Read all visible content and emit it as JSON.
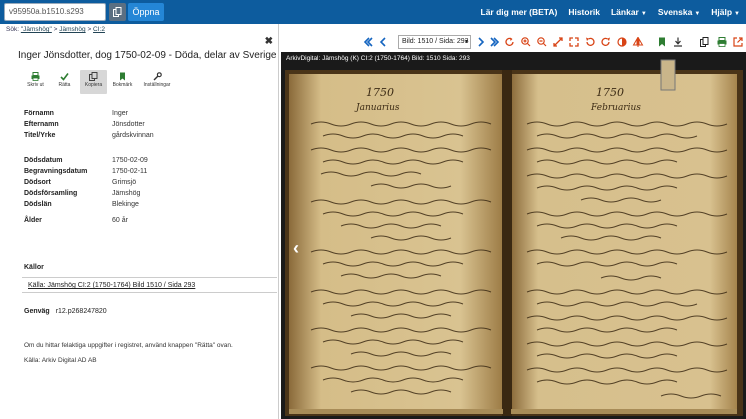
{
  "navbar": {
    "search_value": "v95950a.b1510.s293",
    "open_label": "Öppna",
    "links": [
      {
        "label": "Lär dig mer (BETA)",
        "dropdown": false
      },
      {
        "label": "Historik",
        "dropdown": false
      },
      {
        "label": "Länkar",
        "dropdown": true
      },
      {
        "label": "Svenska",
        "dropdown": true
      },
      {
        "label": "Hjälp",
        "dropdown": true
      }
    ]
  },
  "breadcrumb": {
    "prefix": "Sök:",
    "search": "\"Jämshög\"",
    "sep": ">",
    "parish": "Jämshög",
    "volume": "CI:2"
  },
  "record": {
    "title": "Inger Jönsdotter, dog 1750-02-09 - Döda, delar av Sverige",
    "toolbar": [
      {
        "label": "Skriv ut",
        "icon": "printer-icon",
        "active": false
      },
      {
        "label": "Rätta",
        "icon": "check-icon",
        "active": false
      },
      {
        "label": "Kopiera",
        "icon": "copy-icon",
        "active": true
      },
      {
        "label": "Bokmärk",
        "icon": "bookmark-icon",
        "active": false
      },
      {
        "label": "Inställningar",
        "icon": "wrench-icon",
        "active": false
      }
    ],
    "fields": [
      {
        "label": "Förnamn",
        "value": "Inger"
      },
      {
        "label": "Efternamn",
        "value": "Jönsdotter"
      },
      {
        "label": "Titel/Yrke",
        "value": "gårdskvinnan"
      },
      {
        "label": "Dödsdatum",
        "value": "1750-02-09"
      },
      {
        "label": "Begravningsdatum",
        "value": "1750-02-11"
      },
      {
        "label": "Dödsort",
        "value": "Grimsjö"
      },
      {
        "label": "Dödsförsamling",
        "value": "Jämshög"
      },
      {
        "label": "Dödslän",
        "value": "Blekinge"
      },
      {
        "label": "Ålder",
        "value": "60 år"
      }
    ],
    "kallor_label": "Källor",
    "kallor_link": "Källa: Jämshög CI:2 (1750-1764) Bild 1510 / Sida 293",
    "genvag_label": "Genväg",
    "genvag_value": "r12.p268247820",
    "note": "Om du hittar felaktiga uppgifter i registret, använd knappen \"Rätta\" ovan.",
    "source": "Källa: Arkiv Digital AD AB"
  },
  "viewer": {
    "page_select": "Bild: 1510 / Sida: 293",
    "caption": "ArkivDigital: Jämshög (K) CI:2 (1750-1764) Bild: 1510 Sida: 293",
    "page_left_year": "1750",
    "page_left_month": "Januarius",
    "page_right_year": "1750",
    "page_right_month": "Februarius",
    "accent_blue": "#1565c0",
    "accent_red": "#d84315",
    "accent_green": "#2e7d32"
  }
}
